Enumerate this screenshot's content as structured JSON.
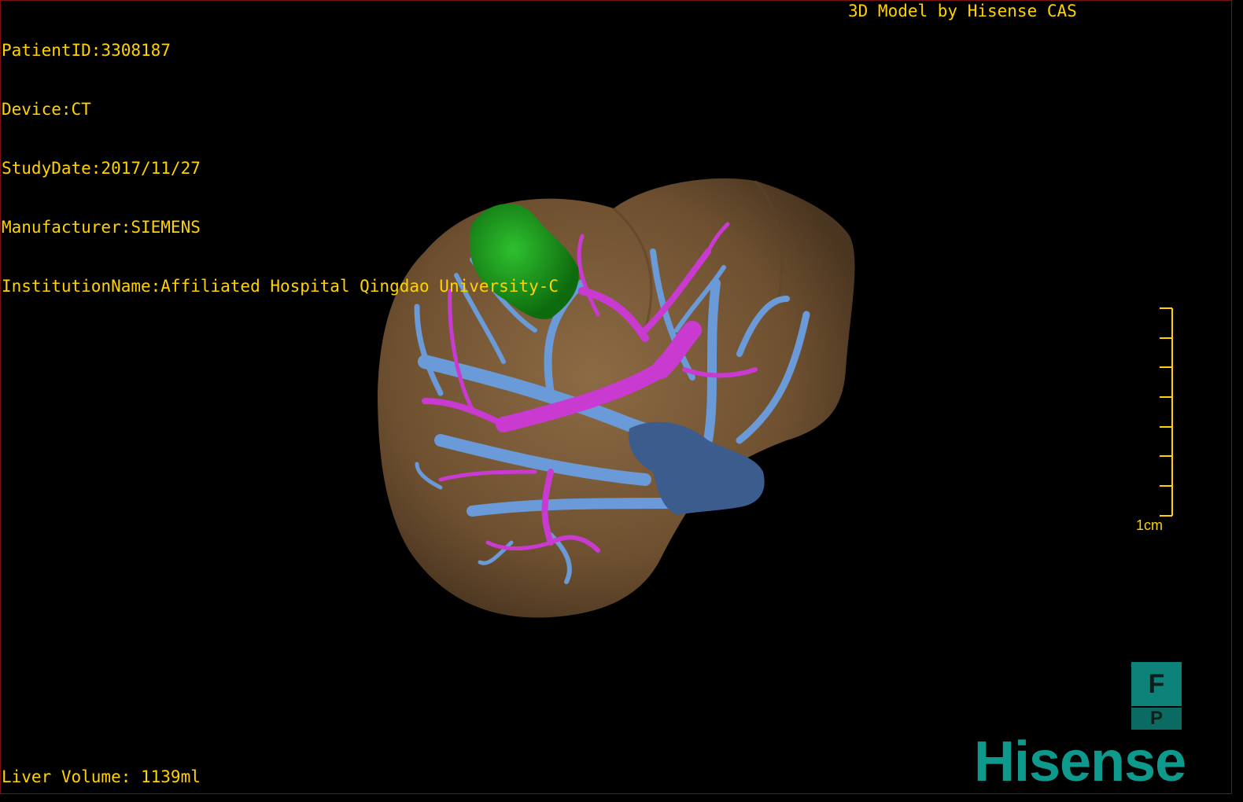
{
  "patient_info": {
    "patient_id": "PatientID:3308187",
    "device": "Device:CT",
    "study_date": "StudyDate:2017/11/27",
    "manufacturer": "Manufacturer:SIEMENS",
    "institution": "InstitutionName:Affiliated Hospital Qingdao University-C"
  },
  "model_credit": "3D Model by Hisense CAS",
  "liver_volume": "Liver Volume: 1139ml",
  "scale_bar": {
    "label": "1cm"
  },
  "orientation": {
    "top": "F",
    "bottom": "P"
  },
  "logo": "Hisense",
  "colors": {
    "text": "#ffd200",
    "liver": "#7a5a36",
    "portal_vein": "#6a9ad8",
    "artery": "#c83ad0",
    "tumor": "#1f9a1f",
    "ivc": "#3a5a8a",
    "brand": "#0d9a8c"
  }
}
